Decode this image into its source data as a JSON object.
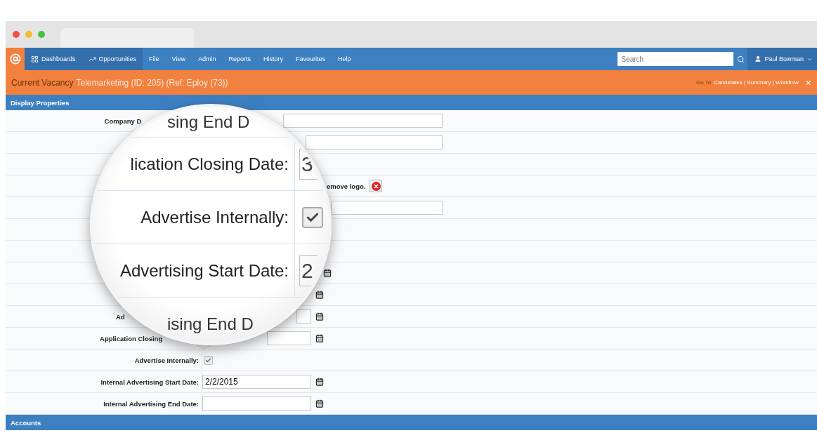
{
  "nav": {
    "items": [
      {
        "label": "Dashboards",
        "selected": true
      },
      {
        "label": "Opportunities",
        "selected": true
      },
      {
        "label": "File",
        "selected": false
      },
      {
        "label": "View",
        "selected": false
      },
      {
        "label": "Admin",
        "selected": false
      },
      {
        "label": "Reports",
        "selected": false
      },
      {
        "label": "History",
        "selected": false
      },
      {
        "label": "Favourites",
        "selected": false
      },
      {
        "label": "Help",
        "selected": false
      }
    ],
    "search": {
      "placeholder": "Search"
    },
    "user": "Paul Bowman"
  },
  "banner": {
    "prefix": "Current Vacancy",
    "title": "Telemarketing (ID: 205) (Ref: Eploy (73))",
    "goto": "Go To",
    "links": "Candidates | Summary | Workflow",
    "close": "×"
  },
  "sections": [
    {
      "title": "Display Properties"
    },
    {
      "title": "Accounts"
    }
  ],
  "rows": [
    {
      "kind": "text",
      "label": "Company D",
      "value": ""
    },
    {
      "kind": "text",
      "value": ""
    },
    {
      "kind": "blank"
    },
    {
      "kind": "logo",
      "note": "emove logo."
    },
    {
      "kind": "text",
      "value": ""
    },
    {
      "kind": "blank"
    },
    {
      "kind": "blank"
    },
    {
      "kind": "date",
      "value": ""
    },
    {
      "kind": "date",
      "value": ""
    },
    {
      "kind": "date",
      "label": "Ad",
      "value": ""
    },
    {
      "kind": "date",
      "label": "Application Closing",
      "value": ""
    },
    {
      "kind": "checkbox",
      "label": "Advertise Internally:",
      "checked": true
    },
    {
      "kind": "date",
      "label": "Internal Advertising Start Date:",
      "value": "2/2/2015"
    },
    {
      "kind": "date",
      "label": "Internal Advertising End Date:",
      "value": ""
    }
  ],
  "magnifier": {
    "lines": [
      {
        "kind": "text",
        "label": "sing End D"
      },
      {
        "kind": "field",
        "label": "lication Closing Date:",
        "value": "3"
      },
      {
        "kind": "checkbox",
        "label": "Advertise Internally:",
        "checked": true
      },
      {
        "kind": "field",
        "label": "Advertising Start Date:",
        "value": "2"
      },
      {
        "kind": "text",
        "label": "ising End D"
      }
    ]
  }
}
